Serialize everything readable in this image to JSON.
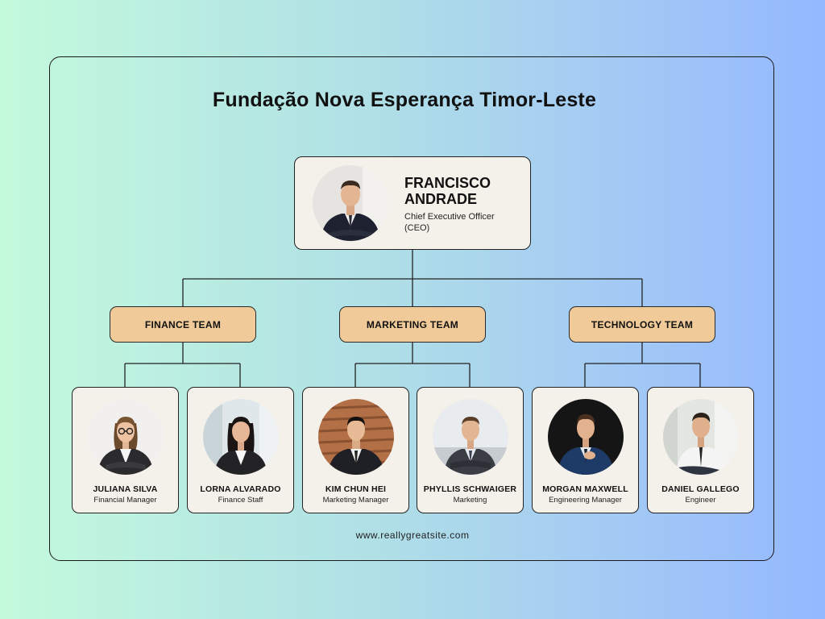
{
  "title": "Fundação Nova Esperança Timor-Leste",
  "ceo": {
    "name": "FRANCISCO ANDRADE",
    "role": "Chief Executive Officer (CEO)",
    "photo": "man-in-suit-portrait-icon"
  },
  "teams": [
    {
      "name": "FINANCE TEAM",
      "members": [
        {
          "name": "JULIANA SILVA",
          "role": "Financial Manager",
          "photo": "woman-with-glasses-portrait-icon"
        },
        {
          "name": "LORNA ALVARADO",
          "role": "Finance Staff",
          "photo": "woman-in-blazer-portrait-icon"
        }
      ]
    },
    {
      "name": "MARKETING TEAM",
      "members": [
        {
          "name": "KIM CHUN HEI",
          "role": "Marketing Manager",
          "photo": "man-in-suit-portrait-icon"
        },
        {
          "name": "PHYLLIS SCHWAIGER",
          "role": "Marketing",
          "photo": "man-arms-crossed-portrait-icon"
        }
      ]
    },
    {
      "name": "TECHNOLOGY TEAM",
      "members": [
        {
          "name": "MORGAN MAXWELL",
          "role": "Engineering Manager",
          "photo": "man-adjusting-tie-portrait-icon"
        },
        {
          "name": "DANIEL GALLEGO",
          "role": "Engineer",
          "photo": "man-seated-portrait-icon"
        }
      ]
    }
  ],
  "website": "www.reallygreatsite.com",
  "colors": {
    "card_bg": "#f4f1ea",
    "team_bg": "#f0cb99",
    "border": "#222222"
  }
}
